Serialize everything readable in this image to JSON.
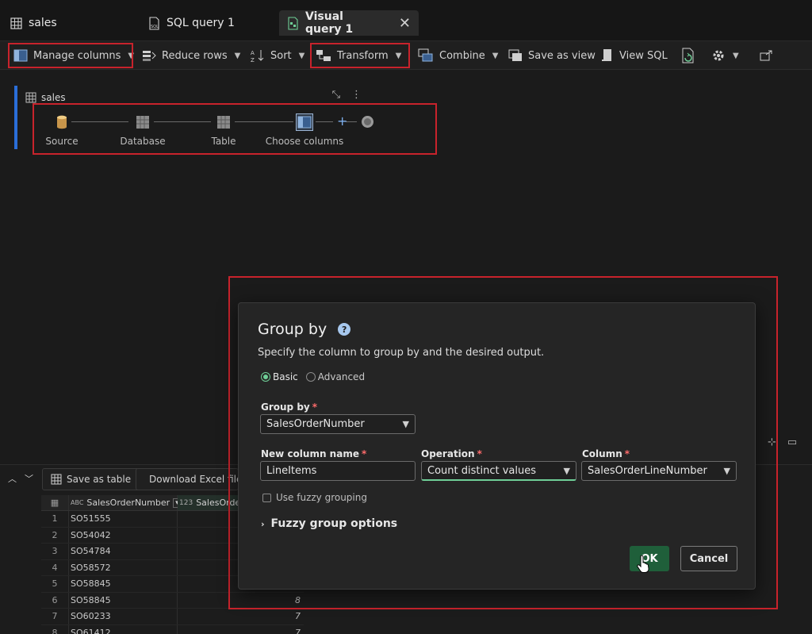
{
  "tabs": [
    {
      "label": "sales",
      "icon": "table-icon"
    },
    {
      "label": "SQL query 1",
      "icon": "sql-file-icon"
    },
    {
      "label": "Visual query 1",
      "icon": "visual-query-icon",
      "active": true
    }
  ],
  "ribbon": {
    "manage_columns": "Manage columns",
    "reduce_rows": "Reduce rows",
    "sort": "Sort",
    "transform": "Transform",
    "combine": "Combine",
    "save_as_view": "Save as view",
    "view_sql": "View SQL"
  },
  "diagram": {
    "title": "sales",
    "steps": [
      "Source",
      "Database",
      "Table",
      "Choose columns"
    ]
  },
  "bottom_panel": {
    "save_as_table": "Save as table",
    "download_excel": "Download Excel file",
    "columns": [
      "SalesOrderNumber",
      "SalesOrder"
    ],
    "column_type_1": "ABC",
    "column_type_2": "123",
    "rows": [
      {
        "n": "1",
        "order": "SO51555",
        "val": ""
      },
      {
        "n": "2",
        "order": "SO54042",
        "val": ""
      },
      {
        "n": "3",
        "order": "SO54784",
        "val": ""
      },
      {
        "n": "4",
        "order": "SO58572",
        "val": ""
      },
      {
        "n": "5",
        "order": "SO58845",
        "val": ""
      },
      {
        "n": "6",
        "order": "SO58845",
        "val": "8"
      },
      {
        "n": "7",
        "order": "SO60233",
        "val": "7"
      },
      {
        "n": "8",
        "order": "SO61412",
        "val": "7"
      }
    ]
  },
  "dialog": {
    "title": "Group by",
    "help": "?",
    "description": "Specify the column to group by and the desired output.",
    "radio_basic": "Basic",
    "radio_advanced": "Advanced",
    "group_by_label": "Group by",
    "group_by_value": "SalesOrderNumber",
    "new_col_label": "New column name",
    "new_col_value": "LineItems",
    "operation_label": "Operation",
    "operation_value": "Count distinct values",
    "column_label": "Column",
    "column_value": "SalesOrderLineNumber",
    "fuzzy_check": "Use fuzzy grouping",
    "fuzzy_options": "Fuzzy group options",
    "ok": "OK",
    "cancel": "Cancel",
    "required": "*"
  },
  "colors": {
    "highlight": "#c8232c",
    "ok_button": "#1f5f3a",
    "accent_green": "#6fcf97",
    "accent_blue": "#2a6ed8"
  }
}
